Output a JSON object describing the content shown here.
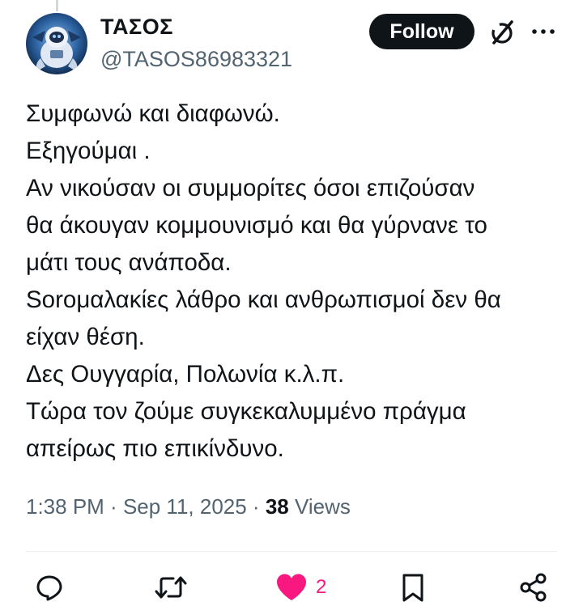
{
  "tweet": {
    "author": {
      "display_name": "ΤΑΣΟΣ",
      "handle": "@TASOS86983321"
    },
    "follow_label": "Follow",
    "text_lines": [
      "Συμφωνώ και διαφωνώ.",
      "Εξηγούμαι .",
      "Αν νικούσαν οι συμμορίτες όσοι επιζούσαν",
      "θα άκουγαν κομμουνισμό και θα γύρνανε το",
      "μάτι τους ανάποδα.",
      "Soroμαλακίες λάθρο και ανθρωπισμοί δεν θα",
      "είχαν θέση.",
      "Δες Ουγγαρία, Πολωνία κ.λ.π.",
      "Τώρα τον ζούμε συγκεκαλυμμένο πράγμα",
      "απείρως πιο επικίνδυνο."
    ],
    "time": "1:38 PM",
    "separator": " · ",
    "date": "Sep 11, 2025",
    "views_count": "38",
    "views_label": " Views",
    "like_count": "2"
  },
  "icons": {
    "header": [
      "grok-icon",
      "more-icon"
    ],
    "actions": [
      "reply-icon",
      "retweet-icon",
      "like-icon",
      "bookmark-icon",
      "share-icon"
    ]
  },
  "colors": {
    "text": "#0f1419",
    "secondary": "#536471",
    "like": "#f91880",
    "follow_bg": "#0f1419",
    "divider": "#eff3f4"
  }
}
